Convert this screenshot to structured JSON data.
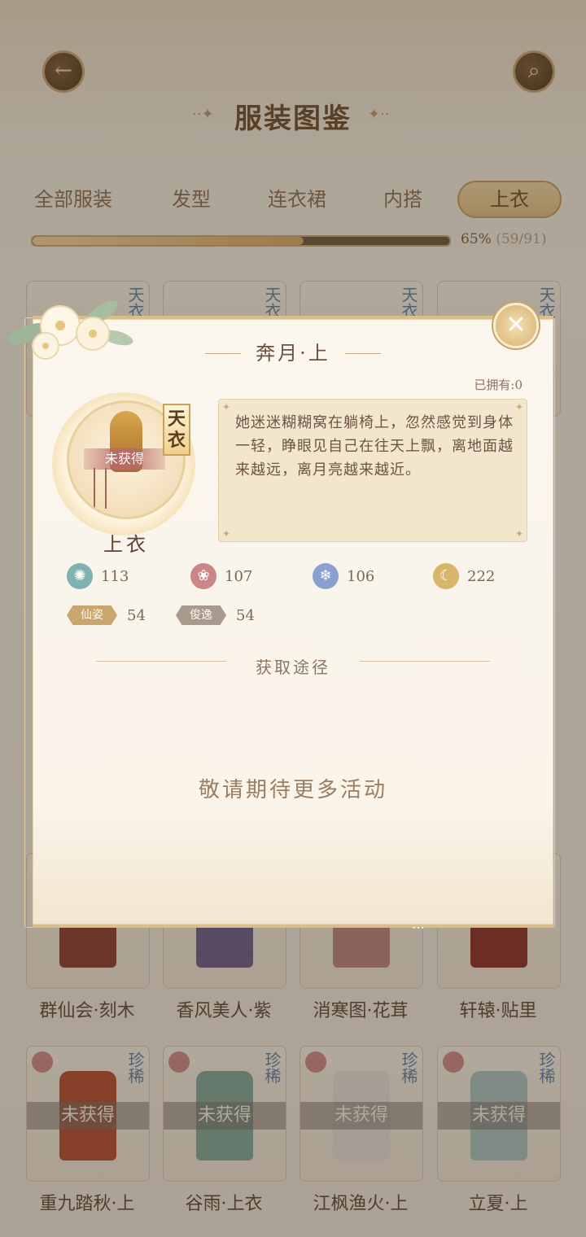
{
  "header": {
    "title": "服装图鉴",
    "back_icon": "back-arrow-icon",
    "search_icon": "search-icon"
  },
  "tabs": [
    {
      "label": "全部服装",
      "active": false
    },
    {
      "label": "发型",
      "active": false
    },
    {
      "label": "连衣裙",
      "active": false
    },
    {
      "label": "内搭",
      "active": false
    },
    {
      "label": "上衣",
      "active": true
    }
  ],
  "progress": {
    "percent_text": "65%",
    "count_text": "(59/91)",
    "fraction": 0.65
  },
  "grid_rows": [
    {
      "labels": [
        "群仙会·刻木",
        "香风美人·紫",
        "消寒图·花茸",
        "轩辕·贴里"
      ],
      "status": "未获得"
    },
    {
      "labels": [
        "重九踏秋·上",
        "谷雨·上衣",
        "江枫渔火·上",
        "立夏·上"
      ],
      "status": "未获得",
      "tag": "珍稀"
    }
  ],
  "top_row_tag": "天衣",
  "modal": {
    "title": "奔月·上",
    "owned": "已拥有:0",
    "status_ribbon": "未获得",
    "rarity": "天衣",
    "item_type": "上衣",
    "description": "她迷迷糊糊窝在躺椅上，忽然感觉到身体一轻，睁眼见自己在往天上飘，离地面越来越远，离月亮越来越近。",
    "stats": [
      {
        "icon": "swirl-icon",
        "value": "113",
        "color": "#7fb3b1"
      },
      {
        "icon": "lotus-icon",
        "value": "107",
        "color": "#c98787"
      },
      {
        "icon": "snowflake-icon",
        "value": "106",
        "color": "#8aa0cf"
      },
      {
        "icon": "moon-icon",
        "value": "222",
        "color": "#d7b56a"
      }
    ],
    "traits": [
      {
        "label": "仙姿",
        "value": "54",
        "color": "#c9a66d"
      },
      {
        "label": "俊逸",
        "value": "54",
        "color": "#a89a8c"
      }
    ],
    "acquire_title": "获取途径",
    "acquire_placeholder": "敬请期待更多活动",
    "ellipsis": "…"
  }
}
